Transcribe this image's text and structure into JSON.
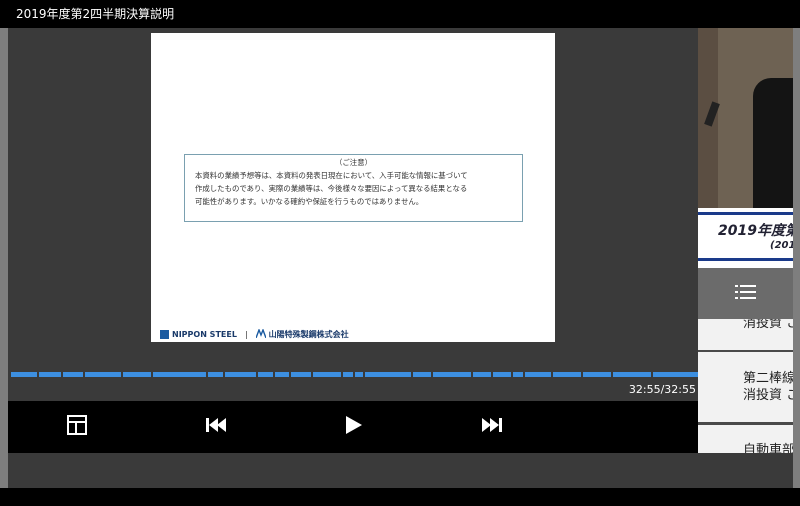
{
  "window": {
    "title": "2019年度第2四半期決算説明"
  },
  "slide": {
    "notice": {
      "heading": "（ご注意）",
      "lines": [
        "本資料の業績予想等は、本資料の発表日現在において、入手可能な情報に基づいて",
        "作成したものであり、実際の業績等は、今後様々な要因によって異なる結果となる",
        "可能性があります。いかなる確約や保証を行うものではありません。"
      ]
    },
    "footer": {
      "brand": "NIPPON STEEL",
      "separator": "|",
      "company": "山陽特殊製鋼株式会社"
    }
  },
  "player": {
    "timecode": "32:55/32:55",
    "progress": 1.0
  },
  "sidebar": {
    "banner_title": "2019年度第",
    "banner_sub": "(201",
    "toc_items": [
      {
        "lines": [
          "消投資 こ"
        ]
      },
      {
        "lines": [
          "第二棒線",
          "消投資 こ"
        ]
      },
      {
        "lines": [
          "自動車部"
        ]
      }
    ]
  },
  "icons": {
    "layout": "layout-icon",
    "prev": "skip-previous-icon",
    "play": "play-icon",
    "next": "skip-next-icon",
    "toc": "list-icon"
  },
  "colors": {
    "accent": "#3d8fe0",
    "background": "#3a3a3a"
  }
}
